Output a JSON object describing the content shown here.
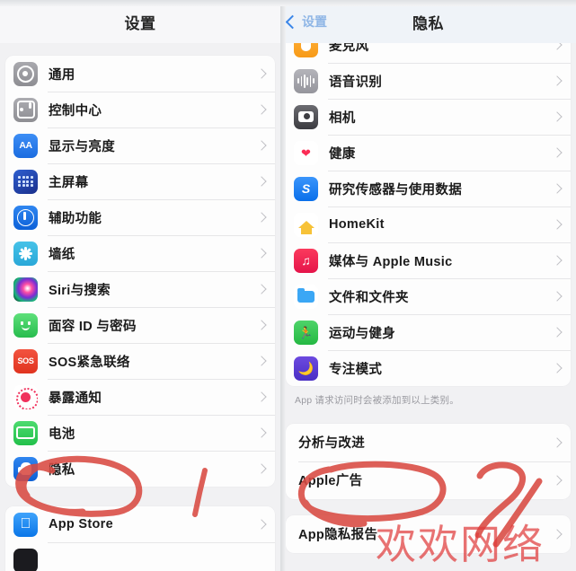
{
  "left_panel": {
    "nav": {
      "title": "设置"
    },
    "sections": [
      {
        "rows": [
          {
            "label": "通用",
            "icon": "gear-icon"
          },
          {
            "label": "控制中心",
            "icon": "control-center-icon"
          },
          {
            "label": "显示与亮度",
            "icon": "display-brightness-icon"
          },
          {
            "label": "主屏幕",
            "icon": "home-screen-icon"
          },
          {
            "label": "辅助功能",
            "icon": "accessibility-icon"
          },
          {
            "label": "墙纸",
            "icon": "wallpaper-icon"
          },
          {
            "label": "Siri与搜索",
            "icon": "siri-icon"
          },
          {
            "label": "面容 ID 与密码",
            "icon": "face-id-icon"
          },
          {
            "label": "SOS紧急联络",
            "icon": "sos-icon"
          },
          {
            "label": "暴露通知",
            "icon": "exposure-notification-icon"
          },
          {
            "label": "电池",
            "icon": "battery-icon"
          },
          {
            "label": "隐私",
            "icon": "privacy-hand-icon"
          }
        ]
      },
      {
        "rows": [
          {
            "label": "App Store",
            "icon": "app-store-icon"
          }
        ]
      }
    ]
  },
  "right_panel": {
    "nav": {
      "back_label": "设置",
      "title": "隐私"
    },
    "sections": [
      {
        "rows": [
          {
            "label": "麦克风",
            "icon": "microphone-icon"
          },
          {
            "label": "语音识别",
            "icon": "speech-recognition-icon"
          },
          {
            "label": "相机",
            "icon": "camera-icon"
          },
          {
            "label": "健康",
            "icon": "health-heart-icon"
          },
          {
            "label": "研究传感器与使用数据",
            "icon": "research-sensor-icon"
          },
          {
            "label": "HomeKit",
            "icon": "homekit-icon"
          },
          {
            "label": "媒体与 Apple Music",
            "icon": "apple-music-icon"
          },
          {
            "label": "文件和文件夹",
            "icon": "files-folder-icon"
          },
          {
            "label": "运动与健身",
            "icon": "fitness-icon"
          },
          {
            "label": "专注模式",
            "icon": "focus-moon-icon"
          }
        ],
        "footnote": "App 请求访问时会被添加到以上类别。"
      },
      {
        "rows": [
          {
            "label": "分析与改进"
          },
          {
            "label": "Apple广告"
          }
        ]
      },
      {
        "rows": [
          {
            "label": "App隐私报告"
          }
        ]
      }
    ]
  },
  "annotations": {
    "color": "#df3c3c",
    "marks": [
      {
        "name": "circle-around-privacy",
        "shape": "ellipse-with-tail"
      },
      {
        "name": "stroke-number-one",
        "shape": "slash"
      },
      {
        "name": "circle-around-apple-ads",
        "shape": "ellipse-with-tail"
      },
      {
        "name": "stroke-number-two",
        "shape": "digit-2"
      }
    ]
  },
  "watermark": {
    "text": "欢欢网络",
    "color": "#df3c3c"
  }
}
